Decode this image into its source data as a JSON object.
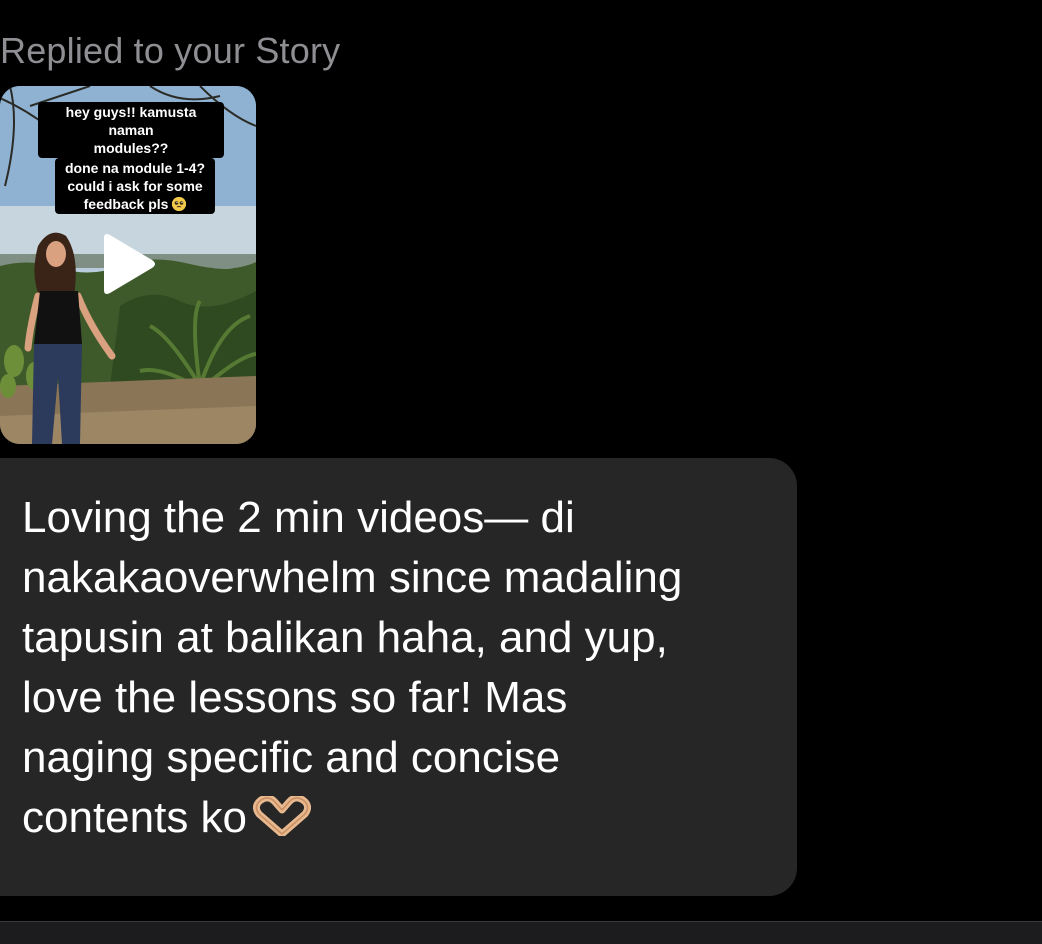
{
  "reply": {
    "header": "Replied to your Story"
  },
  "story": {
    "caption_1": "hey guys!! kamusta naman\nmodules??",
    "caption_2": "done na module 1-4?\ncould i ask for some\nfeedback pls",
    "caption_2_emoji": "pleading-face-icon",
    "overlay_icon": "play-icon"
  },
  "message": {
    "text": "Loving the 2 min videos— di\nnakakaoverwhelm since madaling\ntapusin at balikan haha, and yup,\nlove the lessons so far! Mas\nnaging specific and concise\ncontents ko",
    "trailing_emoji": "heart-hands-icon"
  },
  "colors": {
    "background": "#000000",
    "bubble": "#262626",
    "header_text": "#8e8e93",
    "message_text": "#ffffff"
  }
}
